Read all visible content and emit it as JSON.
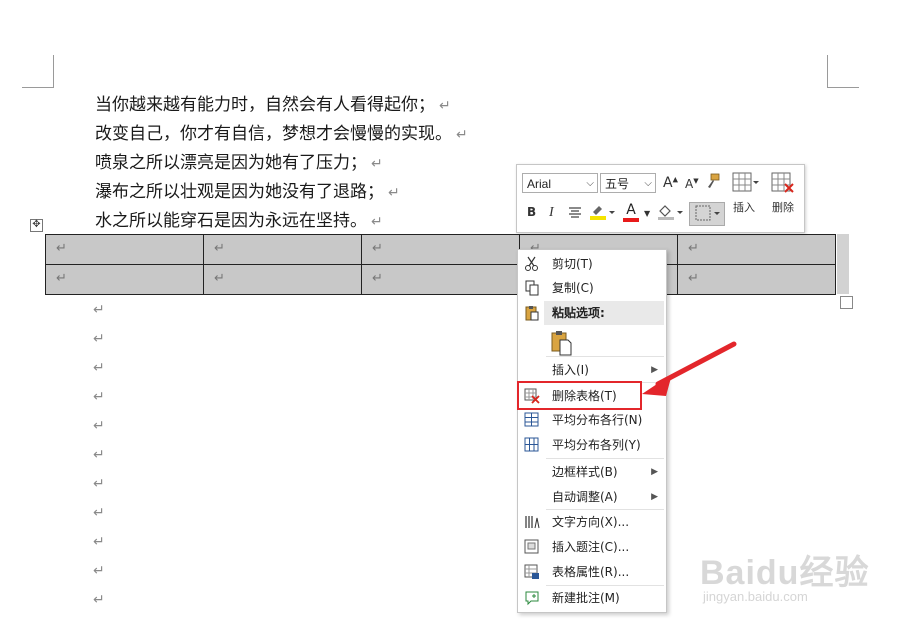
{
  "document": {
    "paragraphs": [
      "当你越来越有能力时，自然会有人看得起你；",
      "改变自己，你才有自信，梦想才会慢慢的实现。",
      "喷泉之所以漂亮是因为她有了压力；",
      "瀑布之所以壮观是因为她没有了退路；",
      "水之所以能穿石是因为永远在坚持。"
    ],
    "paragraph_mark": "↵",
    "table_handle_icon": "move-cross-icon",
    "table_rows": [
      [
        "↵",
        "↵",
        "↵",
        "↵",
        "↵"
      ],
      [
        "↵",
        "↵",
        "↵",
        "↵",
        "↵"
      ]
    ]
  },
  "mini_toolbar": {
    "font_name": "Arial",
    "font_size": "五号",
    "grow_font_label": "A",
    "shrink_font_label": "A",
    "bold_label": "B",
    "italic_label": "I",
    "font_color_label": "A",
    "insert_label": "插入",
    "delete_label": "删除",
    "highlight_color": "#f5e400",
    "font_color": "#e81a1a"
  },
  "context_menu": {
    "cut": "剪切(T)",
    "copy": "复制(C)",
    "paste_options": "粘贴选项:",
    "insert": "插入(I)",
    "delete_table": "删除表格(T)",
    "distribute_rows": "平均分布各行(N)",
    "distribute_cols": "平均分布各列(Y)",
    "border_styles": "边框样式(B)",
    "autofit": "自动调整(A)",
    "text_direction": "文字方向(X)...",
    "insert_caption": "插入题注(C)...",
    "table_properties": "表格属性(R)...",
    "new_comment": "新建批注(M)",
    "submenu_arrow": "▶"
  },
  "annotation": {
    "highlight_color": "#e3262b"
  },
  "watermark": {
    "brand": "Baidu经验",
    "url": "jingyan.baidu.com"
  }
}
